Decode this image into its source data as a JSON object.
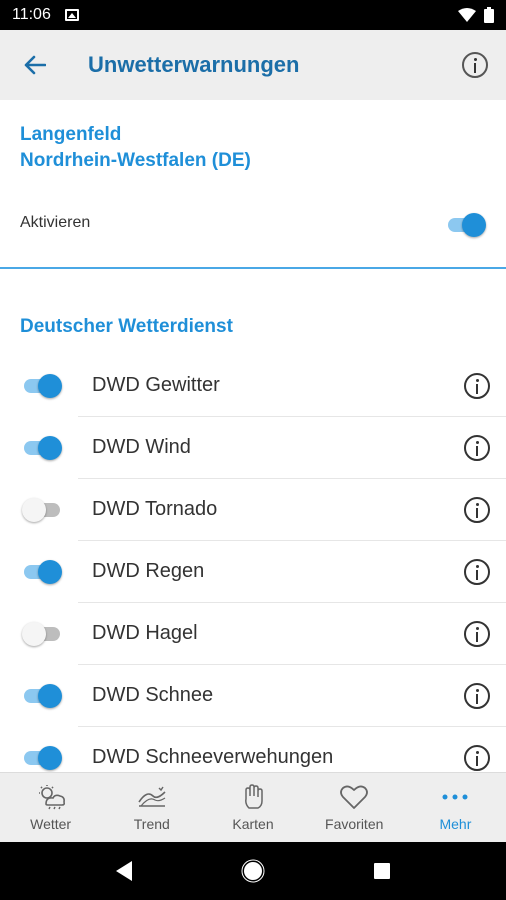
{
  "status_bar": {
    "time": "11:06"
  },
  "app_bar": {
    "title": "Unwetterwarnungen"
  },
  "location": {
    "city": "Langenfeld",
    "region": "Nordrhein-Westfalen (DE)"
  },
  "activate": {
    "label": "Aktivieren",
    "enabled": true
  },
  "section": {
    "title": "Deutscher Wetterdienst"
  },
  "warnings": [
    {
      "label": "DWD Gewitter",
      "enabled": true
    },
    {
      "label": "DWD Wind",
      "enabled": true
    },
    {
      "label": "DWD Tornado",
      "enabled": false
    },
    {
      "label": "DWD Regen",
      "enabled": true
    },
    {
      "label": "DWD Hagel",
      "enabled": false
    },
    {
      "label": "DWD Schnee",
      "enabled": true
    },
    {
      "label": "DWD Schneeverwehungen",
      "enabled": true
    }
  ],
  "bottom_nav": [
    {
      "label": "Wetter",
      "icon": "weather-icon"
    },
    {
      "label": "Trend",
      "icon": "trend-icon"
    },
    {
      "label": "Karten",
      "icon": "map-hand-icon"
    },
    {
      "label": "Favoriten",
      "icon": "heart-icon"
    },
    {
      "label": "Mehr",
      "icon": "more-dots-icon",
      "active": true
    }
  ],
  "colors": {
    "accent": "#1f8fd8",
    "title": "#1b6ea8",
    "toggle_track_on": "#8cc8f0"
  }
}
